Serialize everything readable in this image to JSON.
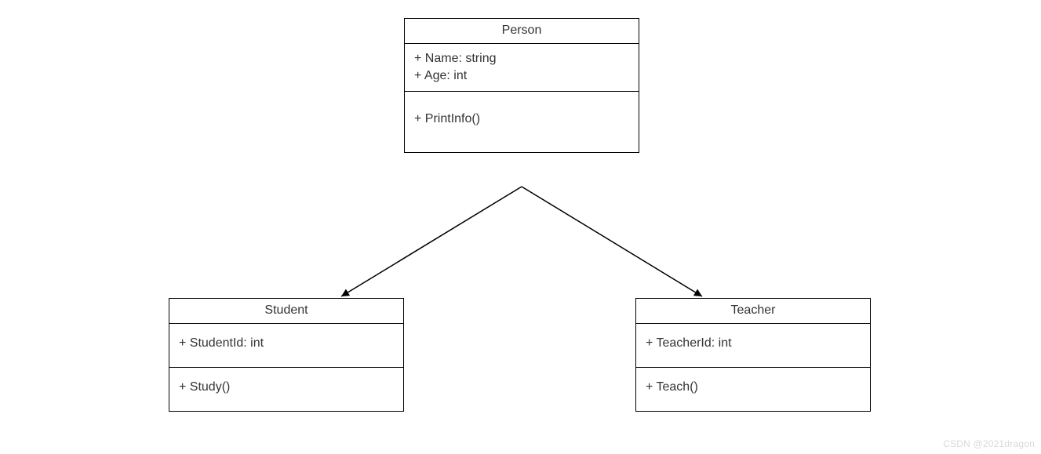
{
  "classes": {
    "person": {
      "name": "Person",
      "attributes": [
        "+ Name: string",
        "+ Age: int"
      ],
      "operations": [
        "+ PrintInfo()"
      ]
    },
    "student": {
      "name": "Student",
      "attributes": [
        "+ StudentId: int"
      ],
      "operations": [
        "+ Study()"
      ]
    },
    "teacher": {
      "name": "Teacher",
      "attributes": [
        "+ TeacherId: int"
      ],
      "operations": [
        "+ Teach()"
      ]
    }
  },
  "watermark": "CSDN @2021dragon"
}
